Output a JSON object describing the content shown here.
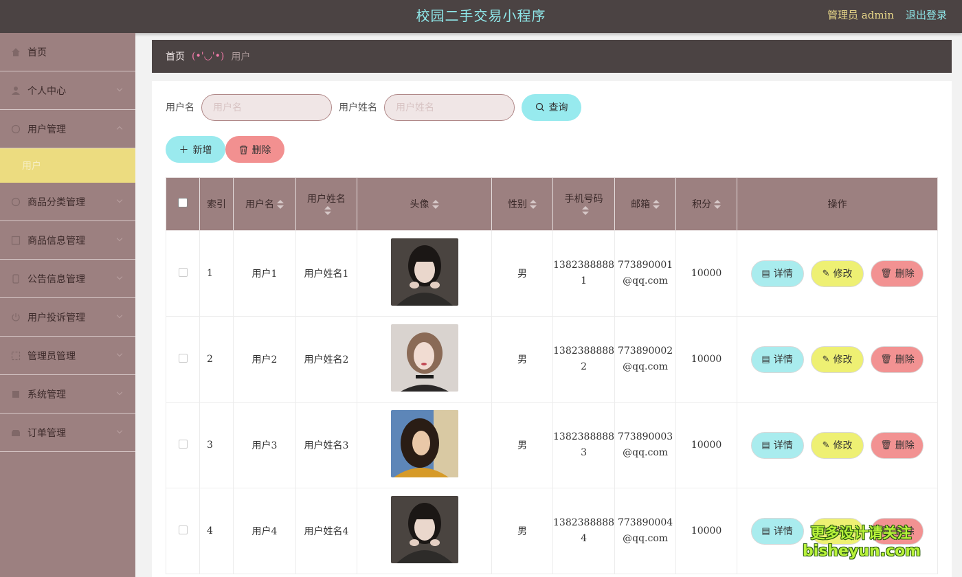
{
  "header": {
    "title": "校园二手交易小程序",
    "admin_label": "管理员 admin",
    "logout": "退出登录"
  },
  "sidebar": {
    "items": [
      {
        "label": "首页",
        "icon": "home-icon"
      },
      {
        "label": "个人中心",
        "icon": "user-icon"
      },
      {
        "label": "用户管理",
        "icon": "users-icon",
        "expanded": true
      },
      {
        "label": "商品分类管理",
        "icon": "category-icon"
      },
      {
        "label": "商品信息管理",
        "icon": "goods-icon"
      },
      {
        "label": "公告信息管理",
        "icon": "notice-icon"
      },
      {
        "label": "用户投诉管理",
        "icon": "complaint-icon"
      },
      {
        "label": "管理员管理",
        "icon": "admin-icon"
      },
      {
        "label": "系统管理",
        "icon": "system-icon"
      },
      {
        "label": "订单管理",
        "icon": "order-icon"
      }
    ],
    "submenu": {
      "label": "用户"
    }
  },
  "breadcrumb": {
    "home": "首页",
    "separator": "(•'◡'•)",
    "current": "用户"
  },
  "search": {
    "username_label": "用户名",
    "username_placeholder": "用户名",
    "realname_label": "用户姓名",
    "realname_placeholder": "用户姓名",
    "query_label": "查询"
  },
  "actions": {
    "add_label": "新增",
    "delete_label": "删除"
  },
  "table": {
    "headers": [
      "索引",
      "用户名",
      "用户姓名",
      "头像",
      "性别",
      "手机号码",
      "邮箱",
      "积分",
      "操作"
    ],
    "row_actions": {
      "detail": "详情",
      "edit": "修改",
      "remove": "删除"
    },
    "rows": [
      {
        "index": "1",
        "username": "用户1",
        "realname": "用户姓名1",
        "gender": "男",
        "phone_a": "1382388888",
        "phone_b": "1",
        "email_a": "773890001",
        "email_b": "@qq.com",
        "points": "10000"
      },
      {
        "index": "2",
        "username": "用户2",
        "realname": "用户姓名2",
        "gender": "男",
        "phone_a": "1382388888",
        "phone_b": "2",
        "email_a": "773890002",
        "email_b": "@qq.com",
        "points": "10000"
      },
      {
        "index": "3",
        "username": "用户3",
        "realname": "用户姓名3",
        "gender": "男",
        "phone_a": "1382388888",
        "phone_b": "3",
        "email_a": "773890003",
        "email_b": "@qq.com",
        "points": "10000"
      },
      {
        "index": "4",
        "username": "用户4",
        "realname": "用户姓名4",
        "gender": "男",
        "phone_a": "1382388888",
        "phone_b": "4",
        "email_a": "773890004",
        "email_b": "@qq.com",
        "points": "10000"
      }
    ]
  },
  "watermark": {
    "line1": "更多设计请关注",
    "line2": "bisheyun.com"
  },
  "colors": {
    "topbar": "#4b4343",
    "sidebar": "#9c8080",
    "accent_cyan": "#97eaee",
    "accent_yellow": "#eef073",
    "accent_red": "#f29090",
    "submenu_active": "#ecdc80"
  }
}
